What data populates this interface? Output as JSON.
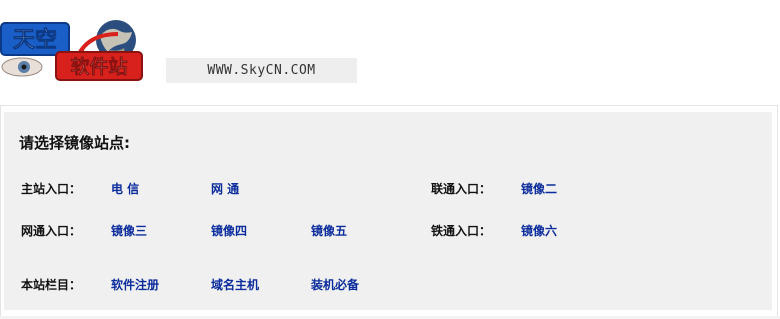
{
  "header": {
    "logo_text_top": "天空",
    "logo_text_bottom": "软件站",
    "url": "WWW.SkyCN.COM"
  },
  "panel": {
    "title": "请选择镜像站点:",
    "rows": [
      {
        "label": "主站入口：",
        "links_left": [
          "电  信",
          "网  通"
        ],
        "right_label": "联通入口：",
        "links_right": [
          "镜像二"
        ]
      },
      {
        "label": "网通入口：",
        "links_left": [
          "镜像三",
          "镜像四",
          "镜像五"
        ],
        "right_label": "铁通入口：",
        "links_right": [
          "镜像六"
        ]
      },
      {
        "label": "本站栏目：",
        "links_left": [
          "软件注册",
          "域名主机",
          "装机必备"
        ]
      }
    ]
  },
  "colors": {
    "link": "#0b2c9c",
    "panel_bg": "#f0f0f0",
    "logo_blue": "#1a5fc8",
    "logo_red": "#d8201c"
  }
}
